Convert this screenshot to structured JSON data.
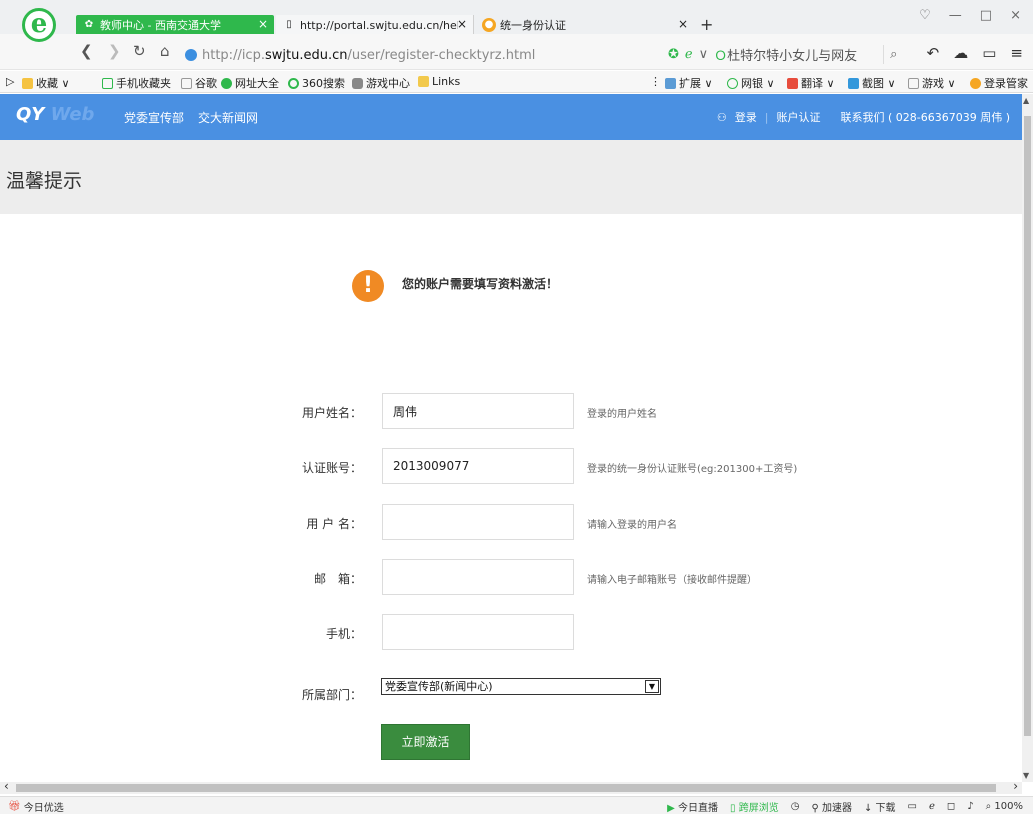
{
  "browser": {
    "logo_glyph": "e",
    "tabs": [
      {
        "title": "教师中心 - 西南交通大学",
        "close": "×"
      },
      {
        "title": "http://portal.swjtu.edu.cn/help",
        "close": "×"
      },
      {
        "title": "统一身份认证",
        "close": "×"
      }
    ],
    "new_tab": "+",
    "window_controls": [
      "♡",
      "—",
      "□",
      "×"
    ],
    "url_prefix": "http://icp.",
    "url_host": "swjtu.edu.cn",
    "url_path": "/user/register-checktyrz.html",
    "search_text": "杜特尔特小女儿与网友",
    "bookmarks": [
      "收藏",
      "手机收藏夹",
      "谷歌",
      "网址大全",
      "360搜索",
      "游戏中心",
      "Links"
    ],
    "extensions": [
      "扩展",
      "网银",
      "翻译",
      "截图",
      "游戏",
      "登录管家"
    ]
  },
  "site": {
    "logo_main": "QY",
    "logo_faded": "Web",
    "nav": [
      "党委宣传部",
      "交大新闻网"
    ],
    "login": "登录",
    "auth": "账户认证",
    "contact": "联系我们 ( 028-66367039 周伟 )"
  },
  "page": {
    "heading": "温馨提示",
    "notice_icon": "!",
    "notice": "您的账户需要填写资料激活！"
  },
  "form": {
    "fields": [
      {
        "label": "用户姓名：",
        "value": "周伟",
        "hint": "登录的用户姓名"
      },
      {
        "label": "认证账号：",
        "value": "2013009077",
        "hint": "登录的统一身份认证账号(eg:201300+工资号)"
      },
      {
        "label": "用 户 名：",
        "value": "",
        "hint": "请输入登录的用户名"
      },
      {
        "label": "邮　箱：",
        "value": "",
        "hint": "请输入电子邮箱账号（接收邮件提醒）"
      },
      {
        "label": "手机：",
        "value": "",
        "hint": ""
      }
    ],
    "department_label": "所属部门：",
    "department_value": "党委宣传部(新闻中心)",
    "submit": "立即激活"
  },
  "status": {
    "left": "今日优选",
    "items": [
      "今日直播",
      "跨屏浏览",
      "加速器",
      "下载"
    ],
    "zoom": "100%"
  },
  "colors": {
    "accent_green": "#2fb84c",
    "header_blue": "#4a90e2",
    "warning_orange": "#f08a24",
    "button_green": "#3a8c3e"
  }
}
